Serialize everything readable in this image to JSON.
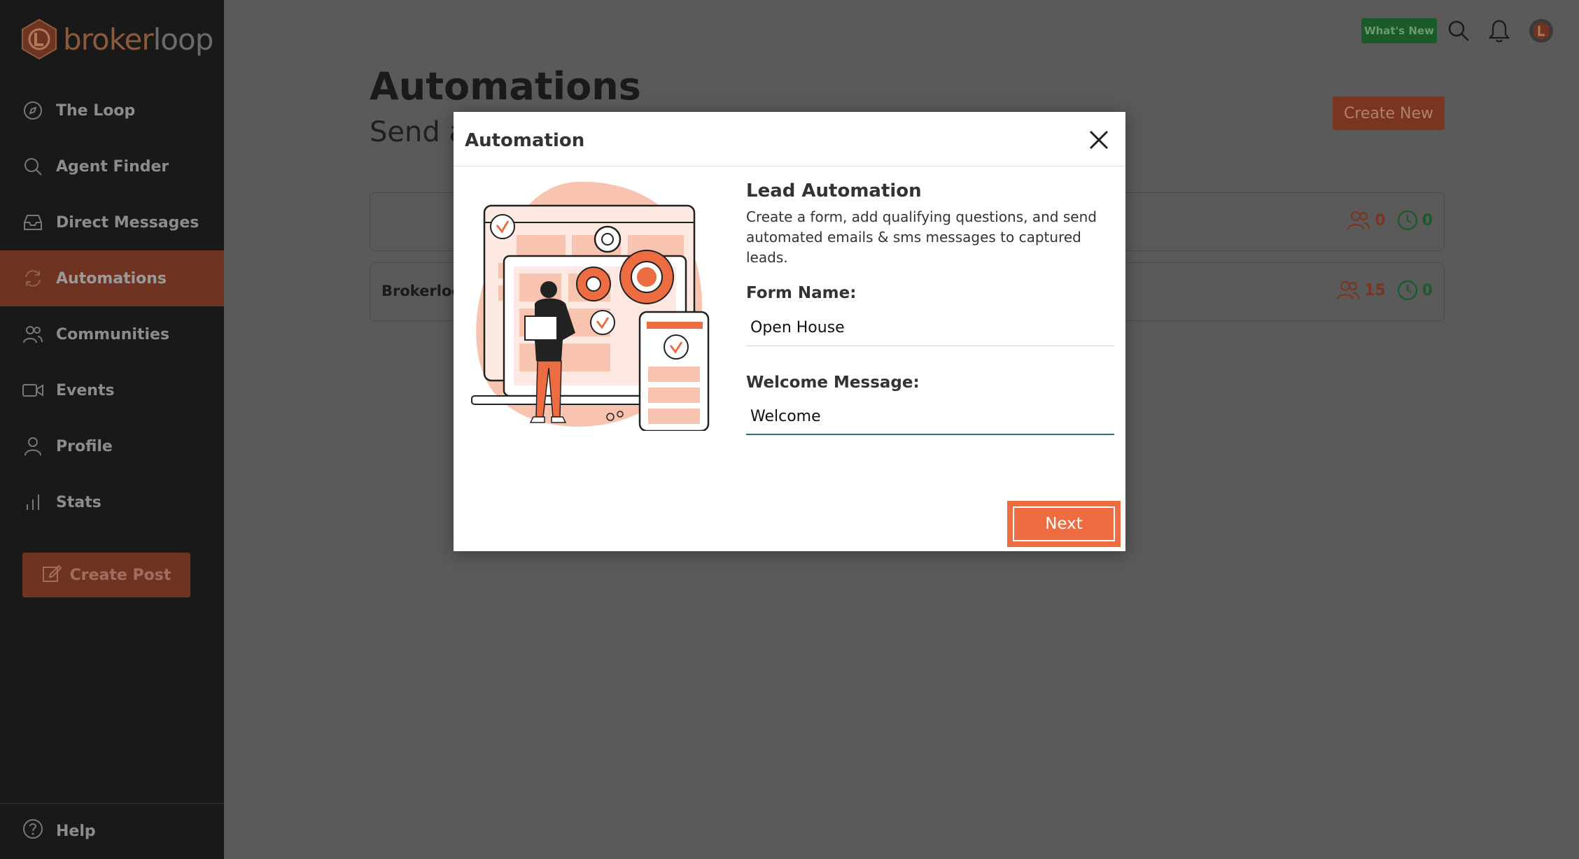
{
  "brand": {
    "name_part1": "broker",
    "name_part2": "loop"
  },
  "sidebar": {
    "items": [
      {
        "label": "The Loop",
        "icon": "compass-icon"
      },
      {
        "label": "Agent Finder",
        "icon": "search-icon"
      },
      {
        "label": "Direct Messages",
        "icon": "inbox-icon"
      },
      {
        "label": "Automations",
        "icon": "refresh-icon",
        "active": true
      },
      {
        "label": "Communities",
        "icon": "users-icon"
      },
      {
        "label": "Events",
        "icon": "video-icon"
      },
      {
        "label": "Profile",
        "icon": "user-icon"
      },
      {
        "label": "Stats",
        "icon": "bar-chart-icon"
      }
    ],
    "create_post": "Create Post",
    "help": "Help"
  },
  "topbar": {
    "whats_new": "What's New"
  },
  "main": {
    "title": "Automations",
    "subtitle": "Send a",
    "create_new": "Create New",
    "rows": [
      {
        "name": "",
        "leads": "0",
        "pending": "0"
      },
      {
        "name": "Brokerloo",
        "leads": "15",
        "pending": "0"
      }
    ]
  },
  "modal": {
    "title": "Automation",
    "lead_title": "Lead Automation",
    "lead_desc": "Create a form, add qualifying questions, and send automated emails & sms messages to captured leads.",
    "form_name_label": "Form Name:",
    "form_name_value": "Open House",
    "welcome_label": "Welcome Message:",
    "welcome_value": "Welcome",
    "next": "Next"
  },
  "colors": {
    "accent": "#ee6c42",
    "sidebar_bg": "#191919",
    "active_item": "#6e3321",
    "whats_new": "#1d5a2a"
  }
}
